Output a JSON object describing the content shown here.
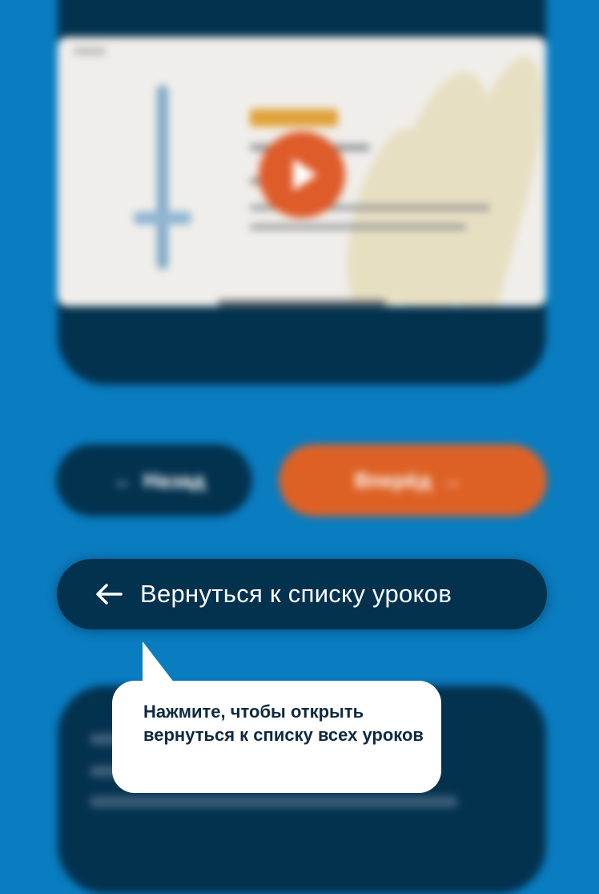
{
  "colors": {
    "background": "#0a7cc0",
    "card": "#03324f",
    "accent": "#dd6125",
    "tooltip_bg": "#ffffff",
    "tooltip_text": "#0f2a3f"
  },
  "video": {
    "play_icon": "play-icon"
  },
  "lesson_nav": {
    "back_label": "Назад",
    "forward_label": "Вперёд",
    "back_icon": "arrow-left-icon",
    "forward_icon": "arrow-right-icon"
  },
  "back_to_list": {
    "label": "Вернуться к списку уроков",
    "icon": "arrow-left-icon"
  },
  "tooltip": {
    "text": "Нажмите, чтобы открыть вернуться к списку всех уроков"
  }
}
